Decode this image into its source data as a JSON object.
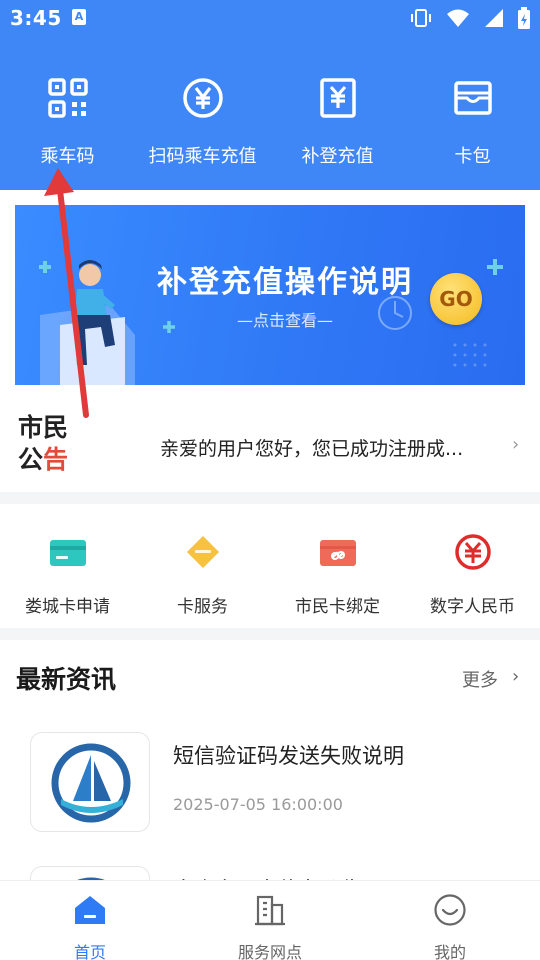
{
  "status_bar": {
    "time": "3:45",
    "badge": "A"
  },
  "quick_nav": [
    {
      "label": "乘车码",
      "icon": "qr-code-icon"
    },
    {
      "label": "扫码乘车充值",
      "icon": "yen-circle-icon"
    },
    {
      "label": "补登充值",
      "icon": "yen-document-icon"
    },
    {
      "label": "卡包",
      "icon": "card-wallet-icon"
    }
  ],
  "banner": {
    "title": "补登充值操作说明",
    "subtitle": "—点击查看—",
    "badge": "GO"
  },
  "notice": {
    "title_line1": "市民",
    "title_line2_a": "公",
    "title_line2_b": "告",
    "text": "亲爱的用户您好，您已成功注册成..."
  },
  "services": [
    {
      "label": "娄城卡申请",
      "icon": "card-apply-icon",
      "color": "#2ec7c0"
    },
    {
      "label": "卡服务",
      "icon": "card-service-icon",
      "color": "#f6c240"
    },
    {
      "label": "市民卡绑定",
      "icon": "card-bind-icon",
      "color": "#f06a5a"
    },
    {
      "label": "数字人民币",
      "icon": "digital-rmb-icon",
      "color": "#e02b2b"
    }
  ],
  "news": {
    "title": "最新资讯",
    "more": "更多",
    "items": [
      {
        "title": "短信验证码发送失败说明",
        "date": "2025-07-05 16:00:00"
      },
      {
        "title": "太仓市民卡停办公告",
        "date": ""
      }
    ]
  },
  "tabbar": [
    {
      "label": "首页",
      "icon": "home-icon",
      "active": true
    },
    {
      "label": "服务网点",
      "icon": "building-icon",
      "active": false
    },
    {
      "label": "我的",
      "icon": "profile-smile-icon",
      "active": false
    }
  ],
  "colors": {
    "brand_blue": "#3f86f7",
    "tab_active": "#2f7bf6",
    "notice_red": "#e14b3b",
    "arrow_red": "#e03a3a"
  }
}
